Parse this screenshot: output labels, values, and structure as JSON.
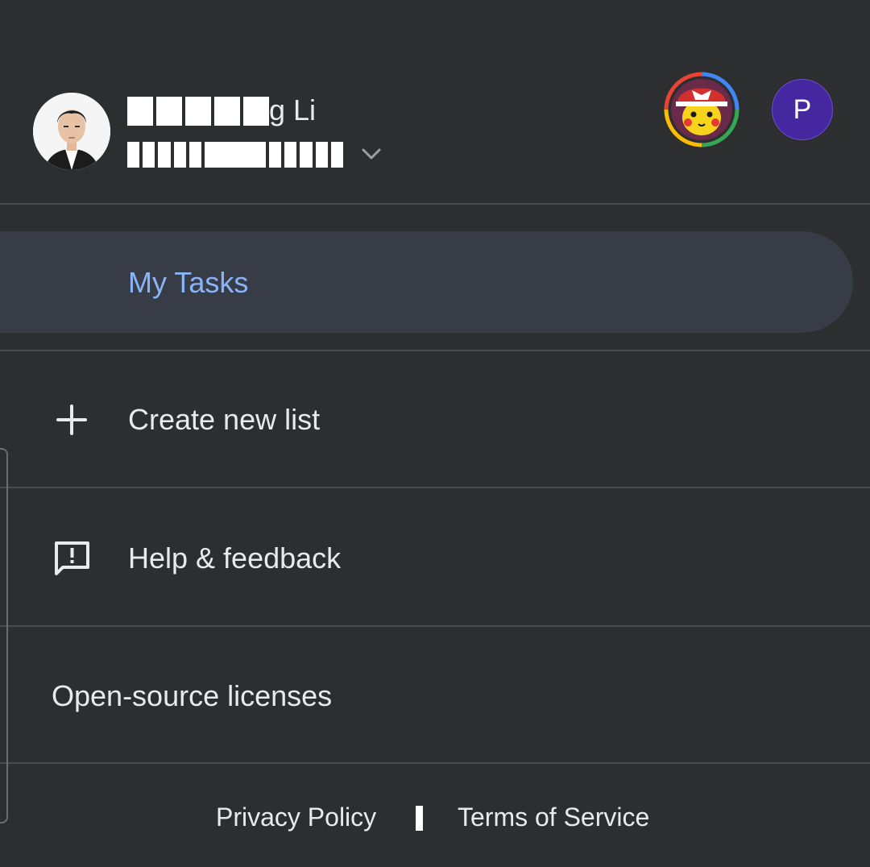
{
  "account": {
    "name_suffix": "g Li",
    "avatar_p_initial": "P"
  },
  "lists": {
    "selected_label": "My Tasks"
  },
  "menu": {
    "create_new_list": "Create new list",
    "help_feedback": "Help & feedback",
    "open_source": "Open-source licenses"
  },
  "footer": {
    "privacy": "Privacy Policy",
    "terms": "Terms of Service"
  },
  "colors": {
    "background": "#2d2e30",
    "selected_bg": "#373c47",
    "selected_text": "#8ab4f8",
    "avatar_p": "#4527a0"
  },
  "icons": {
    "account_switch": "chevron-down-icon",
    "create": "plus-icon",
    "help": "feedback-icon"
  }
}
